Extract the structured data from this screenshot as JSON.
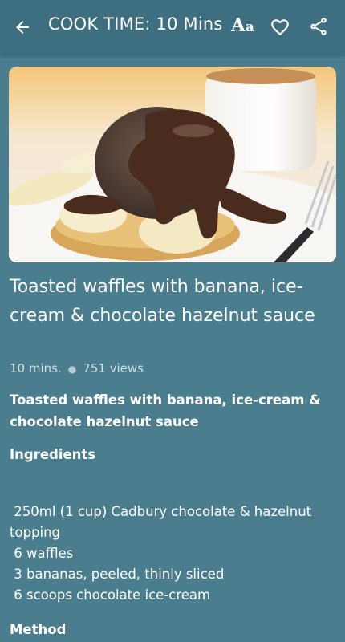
{
  "app_bar": {
    "title": "COOK TIME: 10 Mins",
    "font_button_big": "A",
    "font_button_small": "a",
    "icons": [
      "arrow-back-icon",
      "font-size-icon",
      "heart-outline-icon",
      "share-icon"
    ]
  },
  "recipe": {
    "title": "Toasted waffles with banana, ice-cream & chocolate hazelnut sauce",
    "duration": "10 mins.",
    "views": "751 views",
    "subtitle": "Toasted waffles with banana, ice-cream & chocolate hazelnut sauce",
    "ingredients_heading": "Ingredients",
    "ingredients": [
      " 250ml (1 cup) Cadbury chocolate & hazelnut topping",
      " 6 waffles",
      " 3 bananas, peeled, thinly sliced",
      " 6 scoops chocolate ice-cream"
    ],
    "method_heading": "Method"
  },
  "colors": {
    "background": "#4a7e8f",
    "app_bar": "#3d6f80",
    "text": "#ffffff",
    "muted_text": "#cfe0e6"
  }
}
